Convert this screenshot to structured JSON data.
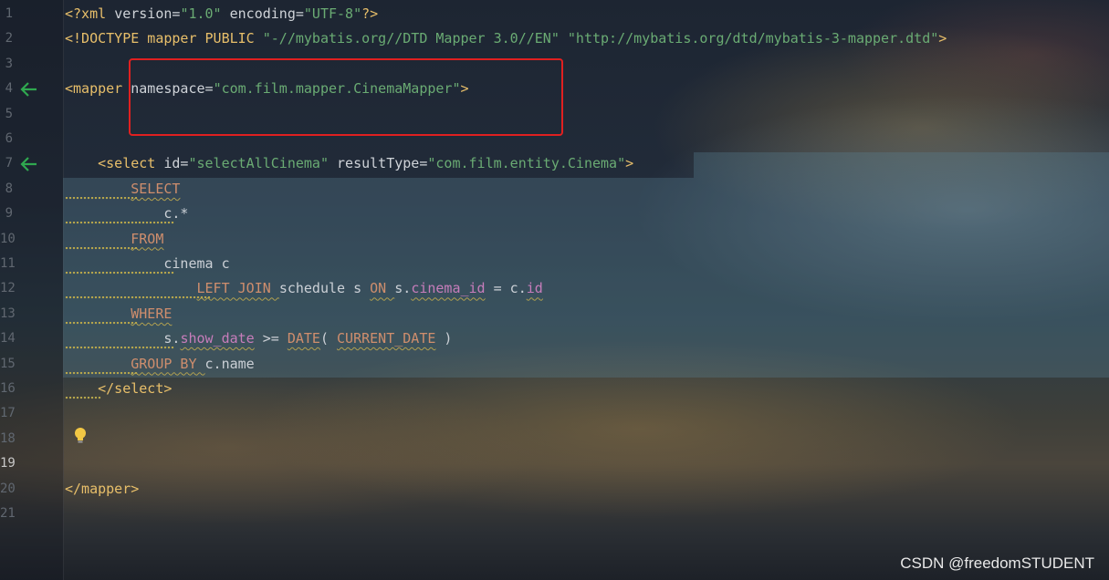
{
  "editor": {
    "lines": [
      {
        "n": "1",
        "parts": [
          [
            "tag",
            "<?xml "
          ],
          [
            "attr",
            "version="
          ],
          [
            "str",
            "\"1.0\" "
          ],
          [
            "attr",
            "encoding="
          ],
          [
            "str",
            "\"UTF-8\""
          ],
          [
            "tag",
            "?>"
          ]
        ]
      },
      {
        "n": "2",
        "parts": [
          [
            "tag",
            "<!DOCTYPE mapper PUBLIC "
          ],
          [
            "str",
            "\"-//mybatis.org//DTD Mapper 3.0//EN\" "
          ],
          [
            "str",
            "\"http://mybatis.org/dtd/mybatis-3-mapper.dtd\""
          ],
          [
            "tag",
            ">"
          ]
        ]
      },
      {
        "n": "3",
        "parts": []
      },
      {
        "n": "4",
        "parts": [
          [
            "tag",
            "<mapper "
          ],
          [
            "attr",
            "namespace="
          ],
          [
            "str",
            "\"com.film.mapper.CinemaMapper\""
          ],
          [
            "tag",
            ">"
          ]
        ]
      },
      {
        "n": "5",
        "parts": []
      },
      {
        "n": "6",
        "parts": []
      },
      {
        "n": "7",
        "parts": [
          [
            "plain",
            "    "
          ],
          [
            "tag",
            "<select "
          ],
          [
            "attr",
            "id="
          ],
          [
            "str",
            "\"selectAllCinema\" "
          ],
          [
            "attr",
            "resultType="
          ],
          [
            "str",
            "\"com.film.entity.Cinema\""
          ],
          [
            "tag",
            ">"
          ]
        ]
      },
      {
        "n": "8",
        "parts": [
          [
            "plain",
            "        "
          ],
          [
            "kw",
            "SELECT"
          ]
        ]
      },
      {
        "n": "9",
        "parts": [
          [
            "plain",
            "            c.*"
          ]
        ]
      },
      {
        "n": "10",
        "parts": [
          [
            "plain",
            "        "
          ],
          [
            "kw",
            "FROM"
          ]
        ]
      },
      {
        "n": "11",
        "parts": [
          [
            "plain",
            "            cinema c"
          ]
        ]
      },
      {
        "n": "12",
        "parts": [
          [
            "plain",
            "                "
          ],
          [
            "kw",
            "LEFT JOIN "
          ],
          [
            "plain",
            "schedule s "
          ],
          [
            "kw",
            "ON "
          ],
          [
            "plain",
            "s."
          ],
          [
            "fld",
            "cinema_id"
          ],
          [
            "plain",
            " = c."
          ],
          [
            "fld",
            "id"
          ]
        ]
      },
      {
        "n": "13",
        "parts": [
          [
            "plain",
            "        "
          ],
          [
            "kw",
            "WHERE"
          ]
        ]
      },
      {
        "n": "14",
        "parts": [
          [
            "plain",
            "            s."
          ],
          [
            "fld",
            "show_date"
          ],
          [
            "plain",
            " >= "
          ],
          [
            "kw",
            "DATE"
          ],
          [
            "plain",
            "( "
          ],
          [
            "kw",
            "CURRENT_DATE"
          ],
          [
            "plain",
            " )"
          ]
        ]
      },
      {
        "n": "15",
        "parts": [
          [
            "plain",
            "        "
          ],
          [
            "kw",
            "GROUP BY "
          ],
          [
            "plain",
            "c.name"
          ]
        ]
      },
      {
        "n": "16",
        "parts": [
          [
            "plain",
            "    "
          ],
          [
            "tag",
            "</select>"
          ]
        ]
      },
      {
        "n": "17",
        "parts": []
      },
      {
        "n": "18",
        "parts": []
      },
      {
        "n": "19",
        "parts": []
      },
      {
        "n": "20",
        "parts": [
          [
            "tag",
            "</mapper>"
          ]
        ]
      },
      {
        "n": "21",
        "parts": []
      }
    ],
    "active_line": "19",
    "gutter_arrow_lines": [
      "4",
      "7"
    ],
    "colors": {
      "tag": "#e8bf6a",
      "string": "#6aab73",
      "keyword": "#cf8e6d",
      "field": "#c77dbb",
      "highlight_box": "#e02020",
      "gutter_arrow": "#2fa84f"
    }
  },
  "watermark": "CSDN @freedomSTUDENT"
}
